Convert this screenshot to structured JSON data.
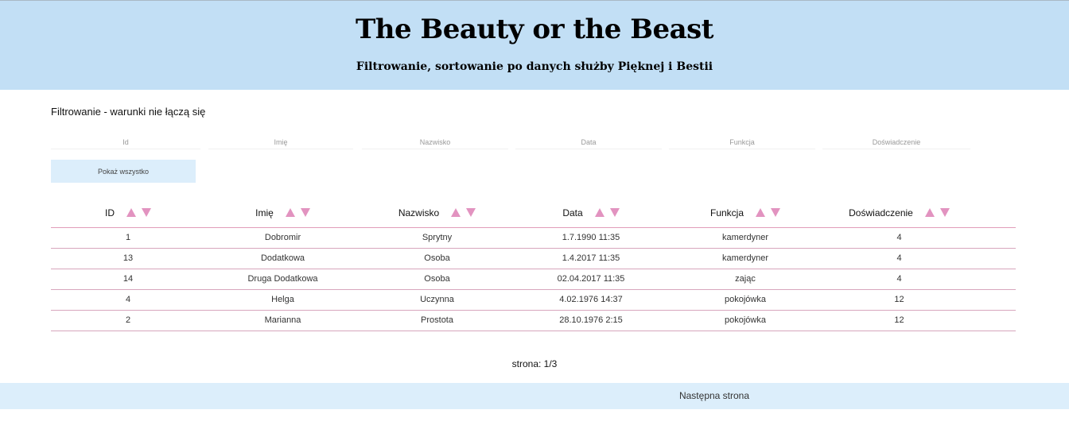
{
  "header": {
    "title": "The Beauty or the Beast",
    "subtitle": "Filtrowanie, sortowanie po danych służby Pięknej i Bestii"
  },
  "filters": {
    "title": "Filtrowanie - warunki nie łączą się",
    "placeholders": {
      "id": "Id",
      "imie": "Imię",
      "nazwisko": "Nazwisko",
      "data": "Data",
      "funkcja": "Funkcja",
      "doswiadczenie": "Doświadczenie"
    },
    "show_all_label": "Pokaż wszystko"
  },
  "table": {
    "columns": [
      "ID",
      "Imię",
      "Nazwisko",
      "Data",
      "Funkcja",
      "Doświadczenie"
    ],
    "rows": [
      [
        "1",
        "Dobromir",
        "Sprytny",
        "1.7.1990 11:35",
        "kamerdyner",
        "4"
      ],
      [
        "13",
        "Dodatkowa",
        "Osoba",
        "1.4.2017 11:35",
        "kamerdyner",
        "4"
      ],
      [
        "14",
        "Druga Dodatkowa",
        "Osoba",
        "02.04.2017 11:35",
        "zając",
        "4"
      ],
      [
        "4",
        "Helga",
        "Uczynna",
        "4.02.1976 14:37",
        "pokojówka",
        "12"
      ],
      [
        "2",
        "Marianna",
        "Prostota",
        "28.10.1976 2:15",
        "pokojówka",
        "12"
      ]
    ]
  },
  "pagination": {
    "page_info": "strona: 1/3",
    "next_label": "Następna strona"
  },
  "colors": {
    "header_bg": "#c2dff5",
    "button_bg": "#dceefb",
    "sort_arrow": "#e293c0",
    "row_border": "#d7a6bd"
  },
  "icons": {
    "sort_asc": "sort-up-icon",
    "sort_desc": "sort-down-icon"
  }
}
